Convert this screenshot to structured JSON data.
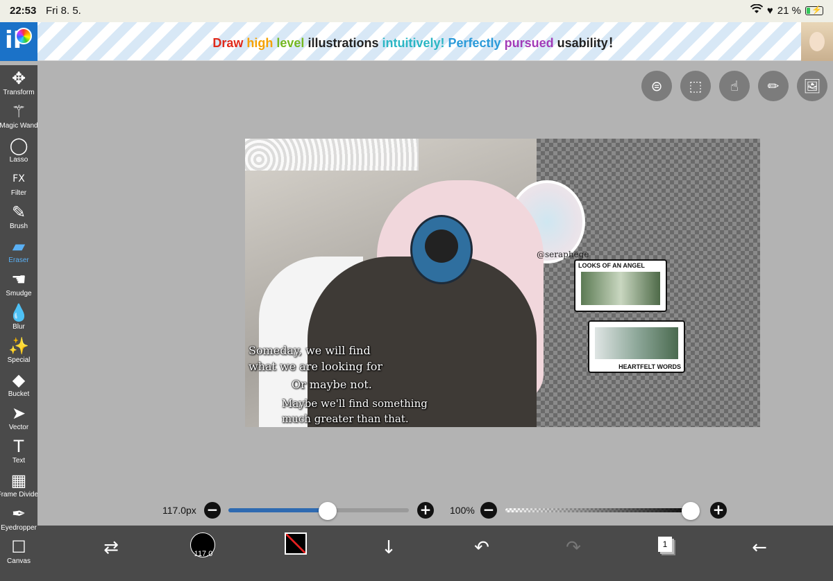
{
  "status_bar": {
    "time": "22:53",
    "date": "Fri 8. 5.",
    "battery": "21 %"
  },
  "ad_banner": {
    "app_logo": "iP",
    "words": [
      {
        "text": "Draw",
        "color": "#e02a1b"
      },
      {
        "text": "high",
        "color": "#f5a100"
      },
      {
        "text": "level",
        "color": "#75b821"
      },
      {
        "text": "illustrations",
        "color": "#222222"
      },
      {
        "text": "intuitively!",
        "color": "#2bb6c4"
      },
      {
        "text": "Perfectly",
        "color": "#2a9ad9"
      },
      {
        "text": "pursued",
        "color": "#a23bb8"
      },
      {
        "text": "usability！",
        "color": "#222222"
      }
    ]
  },
  "tools": [
    {
      "label": "Transform",
      "icon": "move-arrows-icon",
      "glyph": "✥"
    },
    {
      "label": "Magic Wand",
      "icon": "magic-wand-icon",
      "glyph": "⚚"
    },
    {
      "label": "Lasso",
      "icon": "lasso-icon",
      "glyph": "◯"
    },
    {
      "label": "Filter",
      "icon": "fx-icon",
      "glyph": "FX"
    },
    {
      "label": "Brush",
      "icon": "brush-icon",
      "glyph": "✎"
    },
    {
      "label": "Eraser",
      "icon": "eraser-icon",
      "glyph": "▰",
      "active": true
    },
    {
      "label": "Smudge",
      "icon": "smudge-icon",
      "glyph": "☚"
    },
    {
      "label": "Blur",
      "icon": "drop-icon",
      "glyph": "💧"
    },
    {
      "label": "Special",
      "icon": "sparkle-wand-icon",
      "glyph": "✨"
    },
    {
      "label": "Bucket",
      "icon": "bucket-icon",
      "glyph": "◆"
    },
    {
      "label": "Vector",
      "icon": "cursor-arrow-icon",
      "glyph": "➤"
    },
    {
      "label": "Text",
      "icon": "text-t-icon",
      "glyph": "T"
    },
    {
      "label": "Frame Divider",
      "icon": "frame-divider-icon",
      "glyph": "▦"
    },
    {
      "label": "Eyedropper",
      "icon": "eyedropper-icon",
      "glyph": "✒"
    },
    {
      "label": "Canvas",
      "icon": "canvas-icon",
      "glyph": "☐"
    }
  ],
  "top_buttons": [
    {
      "icon": "toggle-switches-icon",
      "glyph": "⊜"
    },
    {
      "icon": "selection-icon",
      "glyph": "⬚"
    },
    {
      "icon": "hand-touch-icon",
      "glyph": "☝"
    },
    {
      "icon": "ruler-icon",
      "glyph": "✏"
    },
    {
      "icon": "image-icon",
      "glyph": "🖼"
    }
  ],
  "artwork": {
    "handle": "@seraphege",
    "card1_title": "LOOKS OF AN ANGEL",
    "card2_title": "HEARTFELT WORDS",
    "quote_lines": [
      "Someday, we will find",
      "what we are looking for",
      "Or maybe not.",
      "Maybe we'll find something",
      "much greater than that."
    ]
  },
  "brush_slider": {
    "label": "117.0px",
    "value_fraction": 0.55
  },
  "opacity_slider": {
    "label": "100%",
    "value_fraction": 1.0
  },
  "bottom_bar": {
    "brush_size": "117.0",
    "layer_count": "1",
    "foreground_color": "#000000"
  }
}
